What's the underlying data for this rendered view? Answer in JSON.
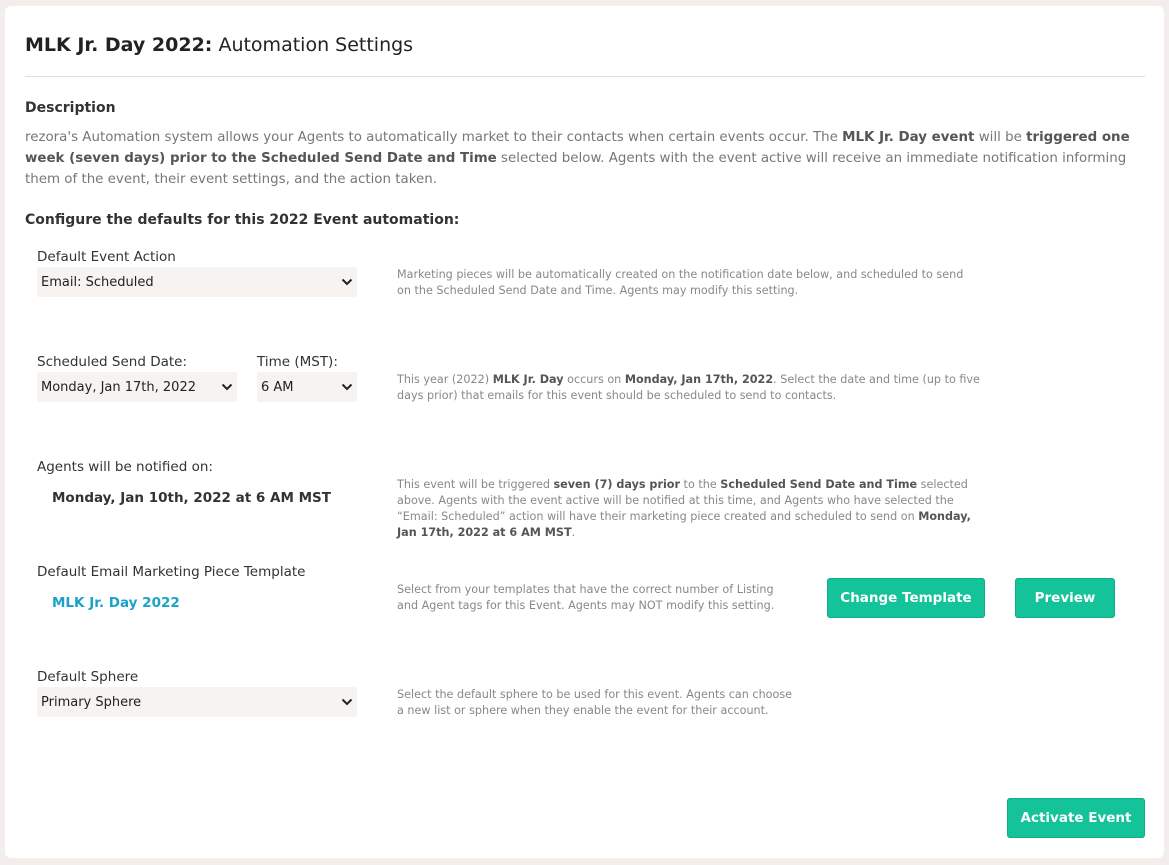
{
  "header": {
    "title_bold": "MLK Jr. Day 2022:",
    "title_rest": " Automation Settings"
  },
  "description": {
    "heading": "Description",
    "p1": "rezora's Automation system allows your Agents to automatically market to their contacts when certain events occur. The ",
    "b1": "MLK Jr. Day event",
    "p2": " will be ",
    "b2": "triggered one week (seven days) prior to the Scheduled Send Date and Time",
    "p3": " selected below. Agents with the event active will receive an immediate notification informing them of the event, their event settings, and the action taken."
  },
  "configure_heading": "Configure the defaults for this 2022 Event automation:",
  "default_action": {
    "label": "Default Event Action",
    "value": "Email: Scheduled",
    "help": "Marketing pieces will be automatically created on the notification date below, and scheduled to send on the Scheduled Send Date and Time. Agents may modify this setting."
  },
  "send_date": {
    "label": "Scheduled Send Date:",
    "value": "Monday, Jan 17th, 2022",
    "time_label": "Time (MST):",
    "time_value": "6 AM",
    "help_p1": "This year (2022) ",
    "help_b1": "MLK Jr. Day",
    "help_p2": " occurs on ",
    "help_b2": "Monday, Jan 17th, 2022",
    "help_p3": ". Select the date and time (up to five days prior) that emails for this event should be scheduled to send to contacts."
  },
  "notify": {
    "label": "Agents will be notified on:",
    "value": "Monday, Jan 10th, 2022 at 6 AM MST",
    "help_p1": "This event will be triggered ",
    "help_b1": "seven (7) days prior",
    "help_p2": " to the ",
    "help_b2": "Scheduled Send Date and Time",
    "help_p3": " selected above. Agents with the event active will be notified at this time, and Agents who have selected the “Email: Scheduled” action will have their marketing piece created and scheduled to send on ",
    "help_b3": "Monday, Jan 17th, 2022 at 6 AM MST",
    "help_p4": "."
  },
  "template": {
    "label": "Default Email Marketing Piece Template",
    "value": "MLK Jr. Day 2022",
    "help": "Select from your templates that have the correct number of Listing and Agent tags for this Event. Agents may NOT modify this setting.",
    "change_label": "Change Template",
    "preview_label": "Preview"
  },
  "sphere": {
    "label": "Default Sphere",
    "value": "Primary Sphere",
    "help": "Select the default sphere to be used for this event. Agents can choose a new list or sphere when they enable the event for their account."
  },
  "footer": {
    "activate_label": "Activate Event"
  },
  "icons": {
    "dropdown": "chevron-down-icon"
  },
  "colors": {
    "accent": "#14c39a",
    "link": "#1aa3c6",
    "select_bg": "#f7f3f1"
  }
}
